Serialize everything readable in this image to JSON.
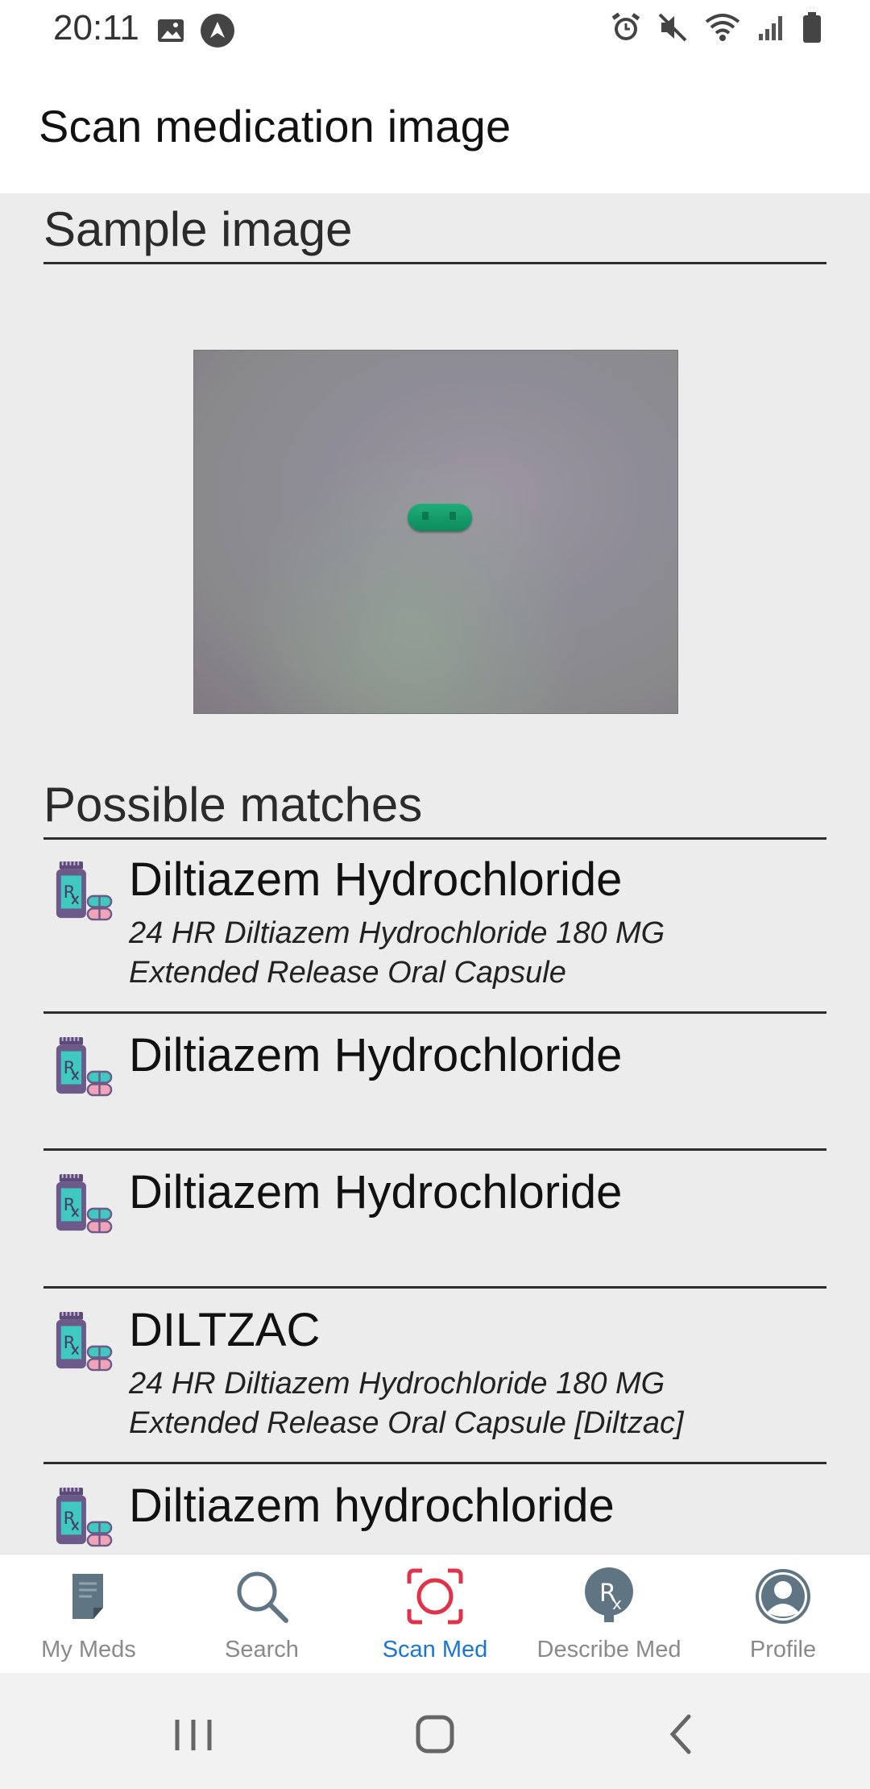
{
  "status_bar": {
    "time": "20:11",
    "left_icons": [
      "image-icon",
      "navigation-app-icon"
    ],
    "right_icons": [
      "alarm-icon",
      "mute-icon",
      "wifi-icon",
      "signal-icon",
      "battery-icon"
    ]
  },
  "app_bar": {
    "title": "Scan medication image"
  },
  "sample": {
    "title": "Sample image"
  },
  "matches": {
    "title": "Possible matches",
    "items": [
      {
        "name": "Diltiazem Hydrochloride",
        "desc_line1": "24 HR Diltiazem Hydrochloride 180 MG",
        "desc_line2": "Extended Release Oral Capsule"
      },
      {
        "name": "Diltiazem Hydrochloride",
        "desc_line1": "",
        "desc_line2": ""
      },
      {
        "name": "Diltiazem Hydrochloride",
        "desc_line1": "",
        "desc_line2": ""
      },
      {
        "name": "DILTZAC",
        "desc_line1": "24 HR Diltiazem Hydrochloride 180 MG",
        "desc_line2": "Extended Release Oral Capsule [Diltzac]"
      },
      {
        "name": "Diltiazem hydrochloride",
        "desc_line1": "",
        "desc_line2": ""
      }
    ]
  },
  "bottom_nav": {
    "items": [
      {
        "label": "My Meds",
        "icon": "notepad-icon"
      },
      {
        "label": "Search",
        "icon": "search-icon"
      },
      {
        "label": "Scan Med",
        "icon": "scan-icon",
        "active": true
      },
      {
        "label": "Describe Med",
        "icon": "rx-icon"
      },
      {
        "label": "Profile",
        "icon": "profile-icon"
      }
    ]
  },
  "colors": {
    "accent": "#1976d2",
    "scan_red": "#e0334a",
    "content_bg": "#ececec",
    "nav_gray": "#8a8a8a"
  }
}
